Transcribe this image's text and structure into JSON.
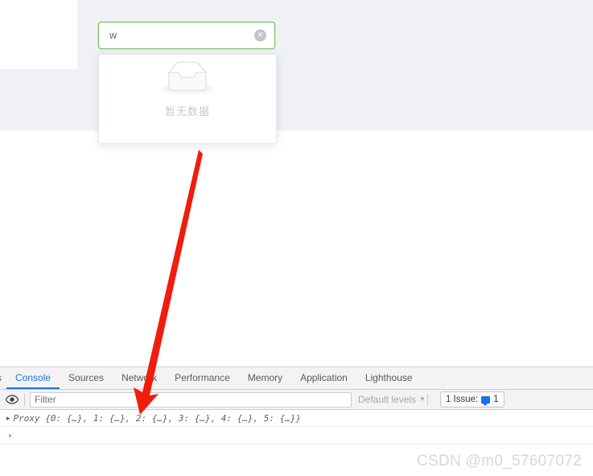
{
  "app": {
    "search": {
      "value": "w",
      "clear_icon": "clear-circle-icon"
    },
    "dropdown": {
      "empty_icon": "empty-inbox-icon",
      "empty_text": "暂无数据"
    },
    "colors": {
      "focus_border": "#6ec35b",
      "backdrop": "#f0f1f4",
      "empty_text": "#c8c9cc"
    }
  },
  "annotation": {
    "arrow_color": "#f01d0e",
    "name": "red-arrow-pointing-to-console"
  },
  "devtools": {
    "tabs": [
      {
        "label": "s",
        "active": false,
        "partial": true
      },
      {
        "label": "Console",
        "active": true,
        "partial": false
      },
      {
        "label": "Sources",
        "active": false,
        "partial": false
      },
      {
        "label": "Network",
        "active": false,
        "partial": false
      },
      {
        "label": "Performance",
        "active": false,
        "partial": false
      },
      {
        "label": "Memory",
        "active": false,
        "partial": false
      },
      {
        "label": "Application",
        "active": false,
        "partial": false
      },
      {
        "label": "Lighthouse",
        "active": false,
        "partial": false
      }
    ],
    "toolbar": {
      "eye_icon": "eye-icon",
      "filter_placeholder": "Filter",
      "filter_value": "",
      "levels_label": "Default levels",
      "levels_caret": "▼",
      "issues_label": "1 Issue:",
      "issues_count": "1"
    },
    "console": {
      "rows": [
        {
          "disclosure": "▸",
          "message": "Proxy {0: {…}, 1: {…}, 2: {…}, 3: {…}, 4: {…}, 5: {…}}"
        }
      ],
      "prompt_caret": "›"
    },
    "accent_color": "#1a73e8"
  },
  "watermark": {
    "text": "CSDN @m0_57607072"
  }
}
